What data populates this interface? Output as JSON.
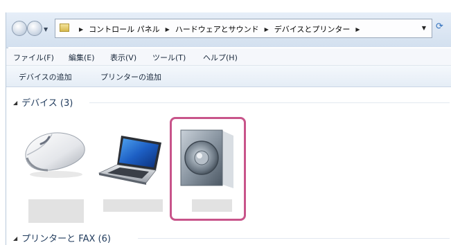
{
  "address_bar": {
    "breadcrumbs": [
      "コントロール パネル",
      "ハードウェアとサウンド",
      "デバイスとプリンター"
    ]
  },
  "menu": {
    "items": [
      "ファイル(F)",
      "編集(E)",
      "表示(V)",
      "ツール(T)",
      "ヘルプ(H)"
    ]
  },
  "commands": {
    "add_device": "デバイスの追加",
    "add_printer": "プリンターの追加"
  },
  "groups": {
    "devices": {
      "header": "デバイス (3)"
    },
    "printers": {
      "header": "プリンターと FAX (6)"
    }
  },
  "devices": [
    {
      "icon": "mouse-icon",
      "label": ""
    },
    {
      "icon": "laptop-icon",
      "label": ""
    },
    {
      "icon": "speaker-icon",
      "label": "",
      "highlighted": true
    }
  ],
  "colors": {
    "highlight": "#c8548a",
    "header_text": "#1e395b"
  }
}
